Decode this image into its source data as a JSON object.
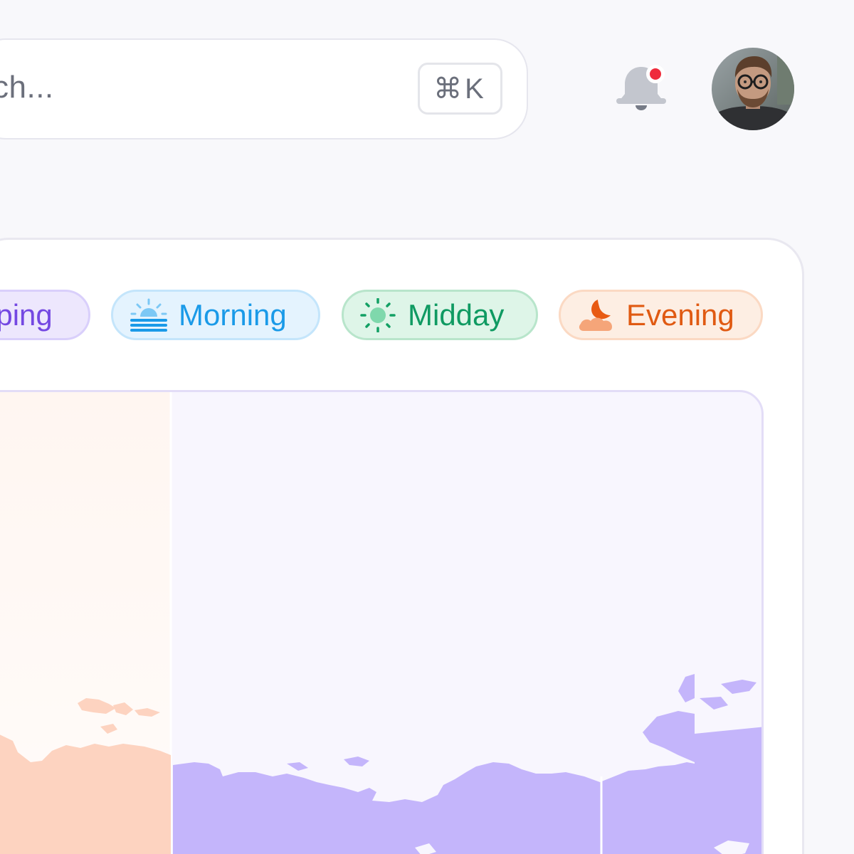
{
  "search": {
    "placeholder_visible": "ch...",
    "shortcut": "⌘K"
  },
  "notifications": {
    "has_unread": true
  },
  "filters": [
    {
      "key": "sleeping",
      "label": "eping",
      "icon": "moon-icon",
      "color": "#7448e2"
    },
    {
      "key": "morning",
      "label": "Morning",
      "icon": "sunrise-icon",
      "color": "#1a9ae8"
    },
    {
      "key": "midday",
      "label": "Midday",
      "icon": "sun-icon",
      "color": "#0f9a62"
    },
    {
      "key": "evening",
      "label": "Evening",
      "icon": "moon-cloud-icon",
      "color": "#e05a12"
    }
  ],
  "map": {
    "highlighted_region_color": "#c4b5fb",
    "evening_region_color": "#fdd3c0"
  }
}
